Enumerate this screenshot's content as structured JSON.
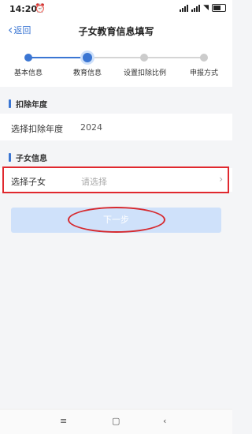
{
  "status_bar": {
    "time": "14:20",
    "alarm_icon": "alarm-icon",
    "signal_text": "",
    "wifi_icon": "wifi-icon",
    "battery_icon": "battery-icon"
  },
  "nav": {
    "back_label": "返回",
    "title": "子女教育信息填写"
  },
  "steps": [
    {
      "label": "基本信息",
      "state": "done"
    },
    {
      "label": "教育信息",
      "state": "current"
    },
    {
      "label": "设置扣除比例",
      "state": "todo"
    },
    {
      "label": "申报方式",
      "state": "todo"
    }
  ],
  "deduction_year": {
    "section_title": "扣除年度",
    "label": "选择扣除年度",
    "value": "2024"
  },
  "child_info": {
    "section_title": "子女信息",
    "label": "选择子女",
    "placeholder": "请选择"
  },
  "next_button": {
    "label": "下一步"
  },
  "colors": {
    "accent": "#3b76d3",
    "inactive_step": "#cccccc",
    "annotation_red": "#e0282e",
    "button_disabled": "#cfe1fa"
  }
}
